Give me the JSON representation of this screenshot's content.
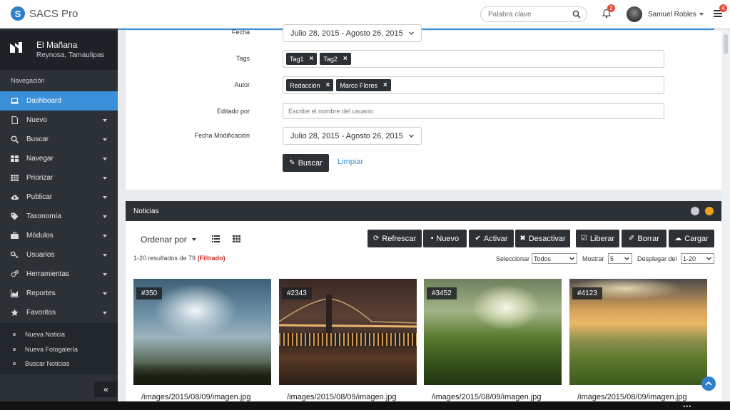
{
  "app": {
    "name": "SACS Pro",
    "logo_letter": "S"
  },
  "header": {
    "search_placeholder": "Palabra clave",
    "notifications_count": "2",
    "user_name": "Samuel Robles",
    "tasks_count": "4"
  },
  "sidebar": {
    "site_name": "El Mañana",
    "site_city": "Reynosa, Tamaulipas",
    "heading": "Navegación",
    "items": [
      {
        "label": "Dashboard",
        "icon": "laptop-icon",
        "active": true
      },
      {
        "label": "Nuevo",
        "icon": "file-icon"
      },
      {
        "label": "Buscar",
        "icon": "search-icon"
      },
      {
        "label": "Navegar",
        "icon": "grid-icon"
      },
      {
        "label": "Priorizar",
        "icon": "table-icon"
      },
      {
        "label": "Publicar",
        "icon": "cloud-upload-icon"
      },
      {
        "label": "Taxonomía",
        "icon": "tags-icon"
      },
      {
        "label": "Módulos",
        "icon": "briefcase-icon"
      },
      {
        "label": "Usuarios",
        "icon": "key-icon"
      },
      {
        "label": "Herramientas",
        "icon": "cogs-icon"
      },
      {
        "label": "Reportes",
        "icon": "area-chart-icon"
      },
      {
        "label": "Favoritos",
        "icon": "star-icon"
      }
    ],
    "favorites": [
      "Nueva Noticia",
      "Nueva Fotogalería",
      "Buscar Noticias"
    ],
    "collapse_label": "«"
  },
  "filters": {
    "fecha_label": "Fecha",
    "fecha_value": "Julio 28, 2015 - Agosto 26, 2015",
    "tags_label": "Tags",
    "tags": [
      "Tag1",
      "Tag2"
    ],
    "autor_label": "Autor",
    "autores": [
      "Redacción",
      "Marco Flores"
    ],
    "editado_label": "Editado por",
    "editado_placeholder": "Escribe el nombre del usuario",
    "fecha_mod_label": "Fecha Modificación",
    "fecha_mod_value": "Julio 28, 2015 - Agosto 26, 2015",
    "search_button": "Buscar",
    "clear_link": "Limpiar",
    "remove_symbol": "×"
  },
  "news": {
    "title": "Noticias",
    "sort_label": "Ordenar por",
    "actions": [
      "Refrescar",
      "Nuevo",
      "Activar",
      "Desactivar",
      "Liberar",
      "Borrar",
      "Cargar"
    ],
    "result_text": "1-20 resultados de 79",
    "filtered_text": "(Filtrado)",
    "select_label": "Seleccionar",
    "select_value": "Todos",
    "show_label": "Mostrar",
    "show_value": "5",
    "display_label": "Desplegar del",
    "display_value": "1-20",
    "cards": [
      {
        "id": "#350",
        "path": "/images/2015/08/09/imagen.jpg"
      },
      {
        "id": "#2343",
        "path": "/images/2015/08/09/imagen.jpg"
      },
      {
        "id": "#3452",
        "path": "/images/2015/08/09/imagen.jpg"
      },
      {
        "id": "#4123",
        "path": "/images/2015/08/09/imagen.jpg"
      }
    ]
  },
  "colors": {
    "primary": "#3a8fd9",
    "sidebar": "#2c3136",
    "danger": "#c9302c"
  },
  "bottom_dots": "•••"
}
